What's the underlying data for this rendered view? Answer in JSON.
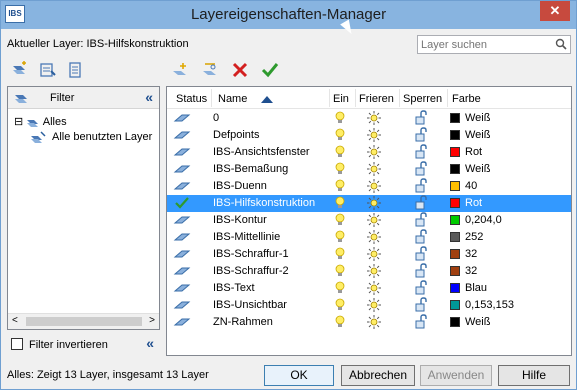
{
  "window": {
    "title": "Layereigenschaften-Manager",
    "logo_text": "IBS",
    "close_label": "✕"
  },
  "current_layer_label": "Aktueller Layer: IBS-Hilfskonstruktion",
  "search": {
    "placeholder": "Layer suchen"
  },
  "filter_panel": {
    "title": "Filter",
    "collapse_glyph": "«",
    "tree": [
      {
        "label": "Alles",
        "expander": "⊟"
      },
      {
        "label": "Alle benutzten Layer"
      }
    ],
    "filter_invert_label": "Filter invertieren"
  },
  "grid": {
    "columns": [
      "Status",
      "Name",
      "Ein",
      "Frieren",
      "Sperren",
      "Farbe"
    ],
    "selected_row_index": 5,
    "rows": [
      {
        "name": "0",
        "color_name": "Weiß",
        "color": "#000000",
        "current": false
      },
      {
        "name": "Defpoints",
        "color_name": "Weiß",
        "color": "#000000",
        "current": false
      },
      {
        "name": "IBS-Ansichtsfenster",
        "color_name": "Rot",
        "color": "#ff0000",
        "current": false
      },
      {
        "name": "IBS-Bemaßung",
        "color_name": "Weiß",
        "color": "#000000",
        "current": false
      },
      {
        "name": "IBS-Duenn",
        "color_name": "40",
        "color": "#ffbf00",
        "current": false
      },
      {
        "name": "IBS-Hilfskonstruktion",
        "color_name": "Rot",
        "color": "#ff0000",
        "current": true
      },
      {
        "name": "IBS-Kontur",
        "color_name": "0,204,0",
        "color": "#00cc00",
        "current": false
      },
      {
        "name": "IBS-Mittellinie",
        "color_name": "252",
        "color": "#5a5a5a",
        "current": false
      },
      {
        "name": "IBS-Schraffur-1",
        "color_name": "32",
        "color": "#a04010",
        "current": false
      },
      {
        "name": "IBS-Schraffur-2",
        "color_name": "32",
        "color": "#a04010",
        "current": false
      },
      {
        "name": "IBS-Text",
        "color_name": "Blau",
        "color": "#0000ff",
        "current": false
      },
      {
        "name": "IBS-Unsichtbar",
        "color_name": "0,153,153",
        "color": "#009999",
        "current": false
      },
      {
        "name": "ZN-Rahmen",
        "color_name": "Weiß",
        "color": "#000000",
        "current": false
      }
    ]
  },
  "status_text": "Alles: Zeigt 13 Layer, insgesamt 13 Layer",
  "buttons": {
    "ok": "OK",
    "cancel": "Abbrechen",
    "apply": "Anwenden",
    "help": "Hilfe"
  },
  "colors": {
    "selection": "#3399ff",
    "titlebar": "#88b4e0"
  }
}
